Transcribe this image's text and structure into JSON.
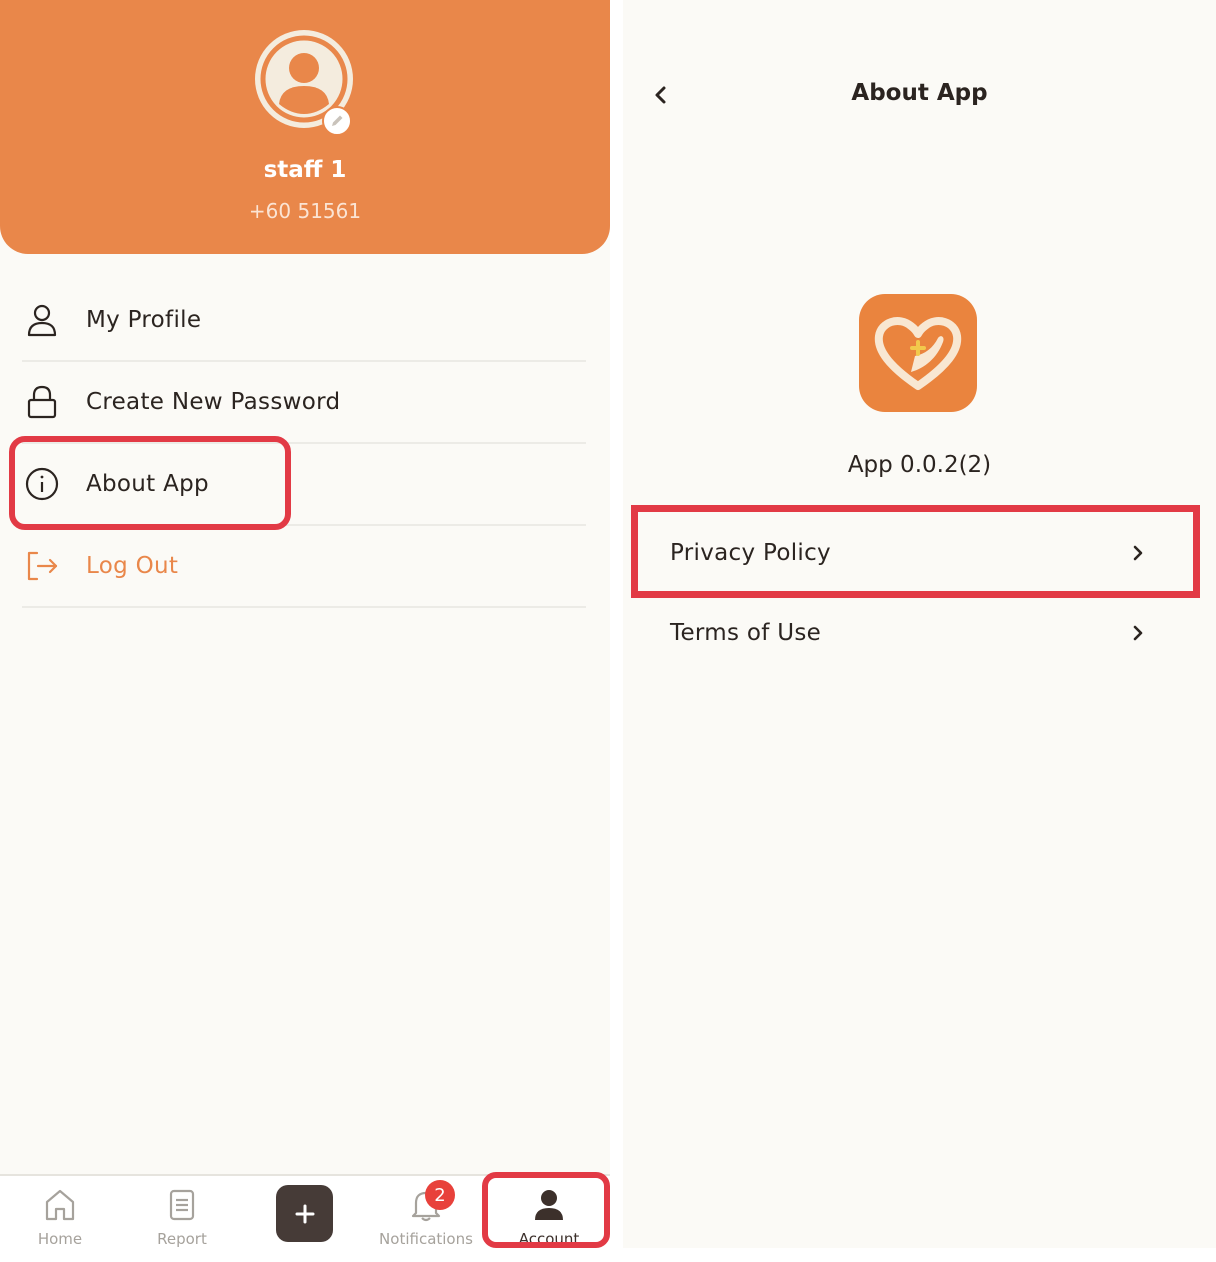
{
  "account": {
    "user_name": "staff 1",
    "user_phone": "+60 51561",
    "avatar_icon": "user-avatar-icon",
    "edit_icon": "pencil-icon",
    "menu": [
      {
        "label": "My Profile",
        "icon": "user-icon"
      },
      {
        "label": "Create New Password",
        "icon": "lock-icon"
      },
      {
        "label": "About App",
        "icon": "info-icon"
      },
      {
        "label": "Log Out",
        "icon": "logout-icon"
      }
    ],
    "bottom_nav": {
      "home_label": "Home",
      "report_label": "Report",
      "add_label": "+",
      "notifications_label": "Notifications",
      "notifications_count": "2",
      "account_label": "Account"
    }
  },
  "about": {
    "title": "About App",
    "back_icon": "chevron-left-icon",
    "version": "App 0.0.2(2)",
    "links": [
      {
        "label": "Privacy Policy",
        "icon": "chevron-right-icon"
      },
      {
        "label": "Terms of Use",
        "icon": "chevron-right-icon"
      }
    ]
  },
  "colors": {
    "brand_orange": "#e9874a",
    "highlight_red": "#e23a45",
    "background": "#fbfaf6",
    "text_dark": "#2b2420",
    "nav_gray": "#a6a29c"
  }
}
